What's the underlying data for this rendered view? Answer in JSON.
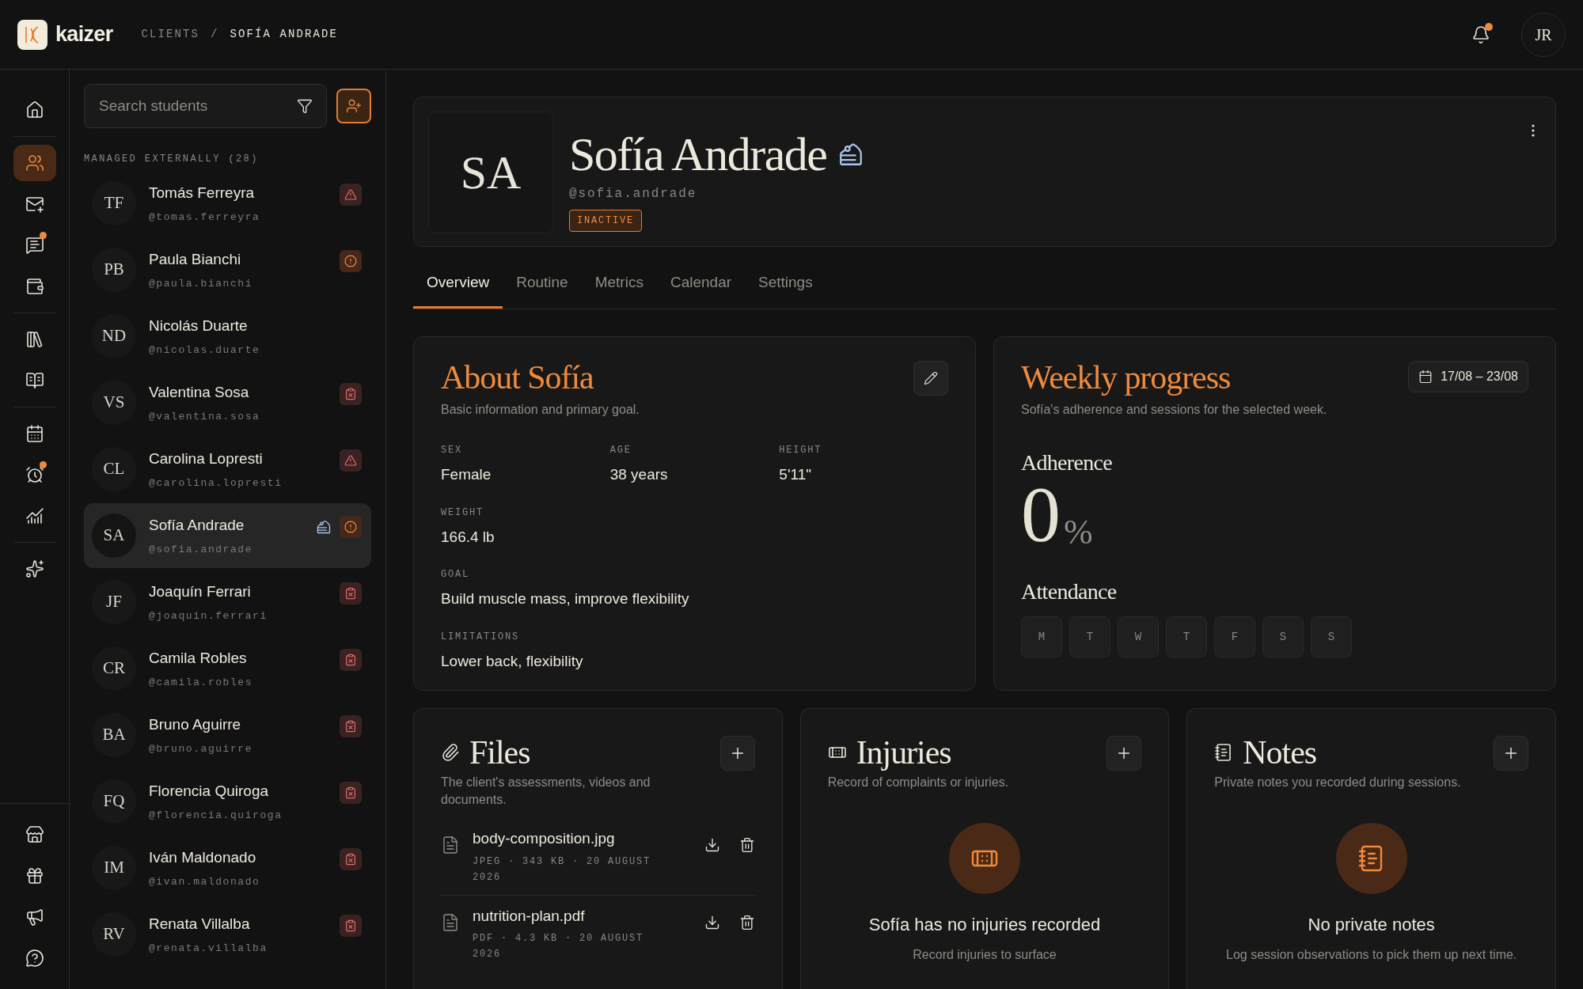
{
  "brand": {
    "name": "kaizer"
  },
  "breadcrumb": [
    {
      "label": "CLIENTS"
    },
    {
      "label": "/"
    },
    {
      "label": "SOFÍA ANDRADE"
    }
  ],
  "header": {
    "notifications_unread": true,
    "user_initials": "JR"
  },
  "nav": {
    "groups": [
      [
        {
          "selected": false,
          "badge": false
        }
      ],
      [
        {
          "selected": true,
          "badge": false
        },
        {
          "selected": false,
          "badge": false
        },
        {
          "selected": false,
          "badge": true
        },
        {
          "selected": false,
          "badge": false
        }
      ],
      [
        {
          "selected": false,
          "badge": false
        },
        {
          "selected": false,
          "badge": false
        }
      ],
      [
        {
          "selected": false,
          "badge": false
        },
        {
          "selected": false,
          "badge": true
        },
        {
          "selected": false,
          "badge": false
        }
      ],
      [
        {
          "selected": false,
          "badge": false
        }
      ]
    ],
    "bottom": [
      {
        "selected": false,
        "badge": false
      },
      {
        "selected": false,
        "badge": false
      },
      {
        "selected": false,
        "badge": false
      },
      {
        "selected": false,
        "badge": false
      }
    ]
  },
  "students": {
    "search_placeholder": "Search students",
    "section": "MANAGED EXTERNALLY (28)",
    "items": [
      {
        "initials": "TF",
        "name": "Tomás Ferreyra",
        "handle": "@tomas.ferreyra",
        "selected": false,
        "birthday": false,
        "kind": "warning"
      },
      {
        "initials": "PB",
        "name": "Paula Bianchi",
        "handle": "@paula.bianchi",
        "selected": false,
        "birthday": false,
        "kind": "alert"
      },
      {
        "initials": "ND",
        "name": "Nicolás Duarte",
        "handle": "@nicolas.duarte",
        "selected": false,
        "birthday": false,
        "kind": "none"
      },
      {
        "initials": "VS",
        "name": "Valentina Sosa",
        "handle": "@valentina.sosa",
        "selected": false,
        "birthday": false,
        "kind": "no-routine"
      },
      {
        "initials": "CL",
        "name": "Carolina Lopresti",
        "handle": "@carolina.lopresti",
        "selected": false,
        "birthday": false,
        "kind": "warning"
      },
      {
        "initials": "SA",
        "name": "Sofía Andrade",
        "handle": "@sofia.andrade",
        "selected": true,
        "birthday": true,
        "kind": "alert"
      },
      {
        "initials": "JF",
        "name": "Joaquín Ferrari",
        "handle": "@joaquin.ferrari",
        "selected": false,
        "birthday": false,
        "kind": "no-routine"
      },
      {
        "initials": "CR",
        "name": "Camila Robles",
        "handle": "@camila.robles",
        "selected": false,
        "birthday": false,
        "kind": "no-routine"
      },
      {
        "initials": "BA",
        "name": "Bruno Aguirre",
        "handle": "@bruno.aguirre",
        "selected": false,
        "birthday": false,
        "kind": "no-routine"
      },
      {
        "initials": "FQ",
        "name": "Florencia Quiroga",
        "handle": "@florencia.quiroga",
        "selected": false,
        "birthday": false,
        "kind": "no-routine"
      },
      {
        "initials": "IM",
        "name": "Iván Maldonado",
        "handle": "@ivan.maldonado",
        "selected": false,
        "birthday": false,
        "kind": "no-routine"
      },
      {
        "initials": "RV",
        "name": "Renata Villalba",
        "handle": "@renata.villalba",
        "selected": false,
        "birthday": false,
        "kind": "no-routine"
      }
    ]
  },
  "profile": {
    "initials": "SA",
    "name": "Sofía Andrade",
    "birthday": true,
    "handle": "@sofia.andrade",
    "status": "INACTIVE"
  },
  "tabs": [
    {
      "label": "Overview",
      "selected": true
    },
    {
      "label": "Routine",
      "selected": false
    },
    {
      "label": "Metrics",
      "selected": false
    },
    {
      "label": "Calendar",
      "selected": false
    },
    {
      "label": "Settings",
      "selected": false
    }
  ],
  "about": {
    "title": "About Sofía",
    "subtitle": "Basic information and primary goal.",
    "fields": [
      [
        {
          "label": "SEX",
          "value": "Female"
        },
        {
          "label": "AGE",
          "value": "38 years"
        },
        {
          "label": "HEIGHT",
          "value": "5'11\""
        }
      ],
      [
        {
          "label": "WEIGHT",
          "value": "166.4 lb"
        }
      ],
      [
        {
          "label": "GOAL",
          "value": "Build muscle mass, improve flexibility"
        }
      ],
      [
        {
          "label": "LIMITATIONS",
          "value": "Lower back, flexibility"
        }
      ]
    ]
  },
  "weekly": {
    "title": "Weekly progress",
    "subtitle": "Sofía's adherence and sessions for the selected week.",
    "range": "17/08 – 23/08",
    "adherence_label": "Adherence",
    "adherence_value": "0",
    "adherence_unit": "%",
    "attendance_label": "Attendance",
    "days": [
      "M",
      "T",
      "W",
      "T",
      "F",
      "S",
      "S"
    ]
  },
  "files": {
    "title": "Files",
    "subtitle": "The client's assessments, videos and documents.",
    "items": [
      {
        "name": "body-composition.jpg",
        "meta": "JPEG · 343 KB · 20 AUGUST 2026"
      },
      {
        "name": "nutrition-plan.pdf",
        "meta": "PDF · 4.3 KB · 20 AUGUST 2026"
      }
    ]
  },
  "injuries": {
    "title": "Injuries",
    "subtitle": "Record of complaints or injuries.",
    "empty_title": "Sofía has no injuries recorded",
    "empty_text": "Record injuries to surface"
  },
  "notes": {
    "title": "Notes",
    "subtitle": "Private notes you recorded during sessions.",
    "empty_title": "No private notes",
    "empty_text": "Log session observations to pick them up next time."
  }
}
